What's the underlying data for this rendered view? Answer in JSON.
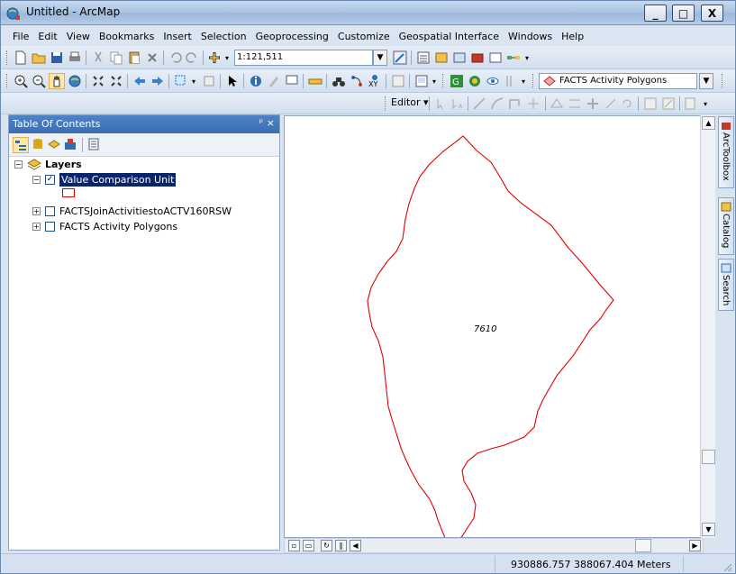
{
  "window": {
    "title": "Untitled - ArcMap",
    "minimize": "_",
    "maximize": "□",
    "close": "X"
  },
  "menu": [
    "File",
    "Edit",
    "View",
    "Bookmarks",
    "Insert",
    "Selection",
    "Geoprocessing",
    "Customize",
    "Geospatial Interface",
    "Windows",
    "Help"
  ],
  "standard_toolbar": {
    "scale": "1:121,511"
  },
  "tools_toolbar": {
    "layer_select": "FACTS Activity Polygons"
  },
  "editor_toolbar": {
    "editor_label": "Editor ▾"
  },
  "toc": {
    "title": "Table Of Contents",
    "pin": "ᵖ",
    "close": "×",
    "layers_group": "Layers",
    "layers": [
      {
        "name": "Value Comparison Unit",
        "checked": true,
        "expanded": true,
        "selected": true
      },
      {
        "name": "FACTSJoinActivitiestoACTV160RSW",
        "checked": false,
        "expanded": false
      },
      {
        "name": "FACTS Activity Polygons",
        "checked": false,
        "expanded": false
      }
    ],
    "symbol_color": "#e00000"
  },
  "map": {
    "feature_label": "7610",
    "outline_color": "#e00000"
  },
  "side_tabs": [
    "ArcToolbox",
    "Catalog",
    "Search"
  ],
  "status": {
    "coordinates": "930886.757  388067.404 Meters"
  }
}
